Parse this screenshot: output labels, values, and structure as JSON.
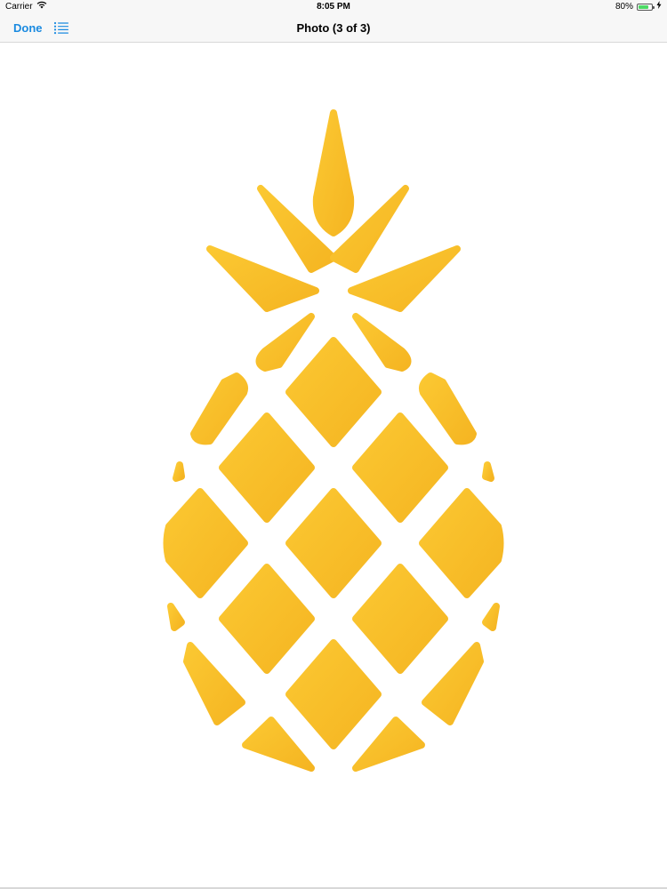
{
  "status_bar": {
    "carrier": "Carrier",
    "time": "8:05 PM",
    "battery_text": "80%",
    "battery_level": 0.8,
    "icons": [
      "wifi-icon",
      "battery-icon",
      "charging-bolt-icon"
    ]
  },
  "nav": {
    "done_label": "Done",
    "list_icon": "list-icon",
    "title": "Photo (3 of 3)"
  },
  "photo": {
    "subject": "pineapple",
    "fill_color": "#F8BE2A",
    "background_color": "#FFFFFF"
  },
  "colors": {
    "accent": "#1A8AE0",
    "bar_background": "#F7F7F7",
    "battery_green": "#4CD964"
  }
}
